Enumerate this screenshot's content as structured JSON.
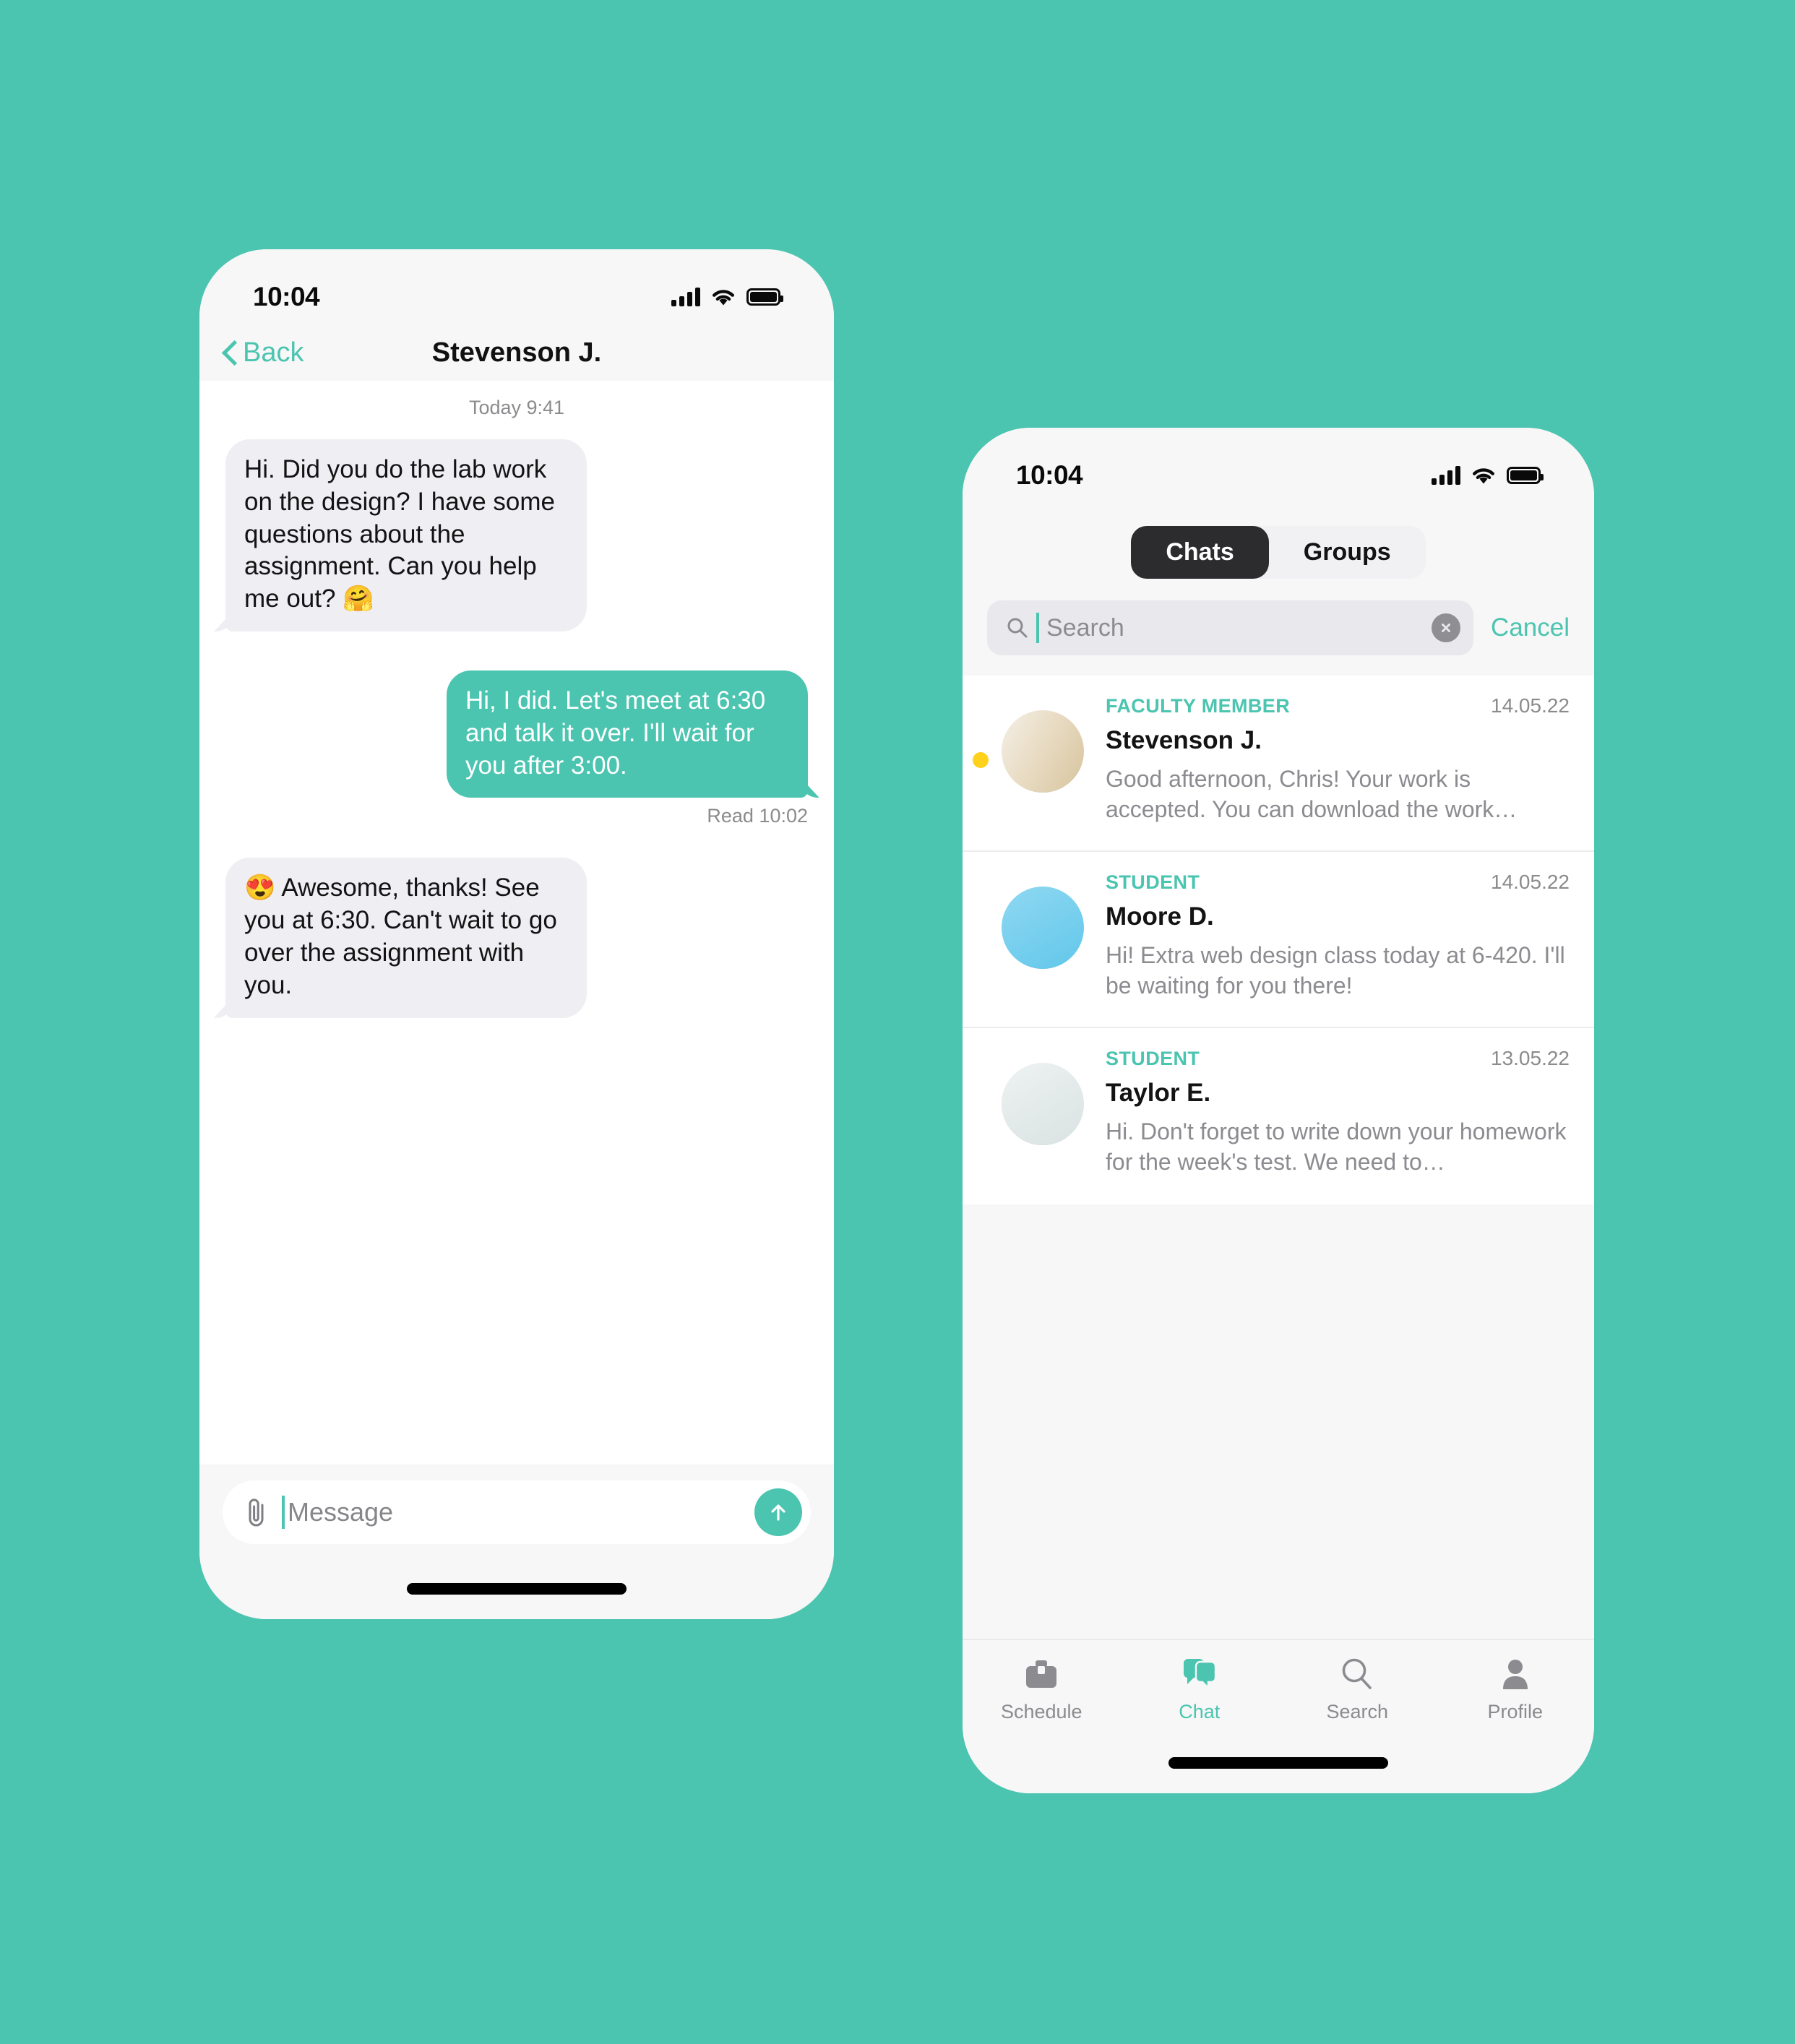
{
  "theme": {
    "background": "#4bc4b0",
    "accent": "#4bc4b0",
    "unread_dot": "#ffd11a",
    "bubble_in": "#eeeef3",
    "bubble_out": "#4bc4b0",
    "tab_active_bg": "#2c2c2e"
  },
  "phone_chat": {
    "status_bar": {
      "time": "10:04"
    },
    "nav": {
      "back_label": "Back",
      "title": "Stevenson J."
    },
    "conversation": {
      "day_stamp": "Today 9:41",
      "messages": [
        {
          "direction": "in",
          "text": "Hi. Did you do the lab work on the design? I have some questions about the assignment. Can you help me out? 🤗"
        },
        {
          "direction": "out",
          "text": "Hi, I did. Let's meet at 6:30 and talk it over. I'll wait for you after 3:00.",
          "receipt": "Read 10:02"
        },
        {
          "direction": "in",
          "text": "😍 Awesome, thanks! See you at 6:30. Can't wait to go over the assignment with you."
        }
      ]
    },
    "composer": {
      "attach_icon": "paperclip-icon",
      "placeholder": "Message",
      "send_icon": "arrow-up-icon"
    }
  },
  "phone_list": {
    "status_bar": {
      "time": "10:04"
    },
    "segmented": {
      "options": [
        "Chats",
        "Groups"
      ],
      "selected": "Chats"
    },
    "search": {
      "icon": "search-icon",
      "placeholder": "Search",
      "value": "",
      "clear_icon": "clear-circle-icon",
      "cancel_label": "Cancel"
    },
    "chats": [
      {
        "role": "FACULTY MEMBER",
        "name": "Stevenson J.",
        "preview": "Good afternoon, Chris! Your work is accepted. You can download the work…",
        "date": "14.05.22",
        "unread": true,
        "avatar": "avatar-stevenson"
      },
      {
        "role": "STUDENT",
        "name": "Moore D.",
        "preview": "Hi! Extra web design class today at 6-420. I'll be waiting for you there!",
        "date": "14.05.22",
        "unread": false,
        "avatar": "avatar-moore"
      },
      {
        "role": "STUDENT",
        "name": "Taylor E.",
        "preview": "Hi. Don't forget to write down your homework for the week's test. We need to…",
        "date": "13.05.22",
        "unread": false,
        "avatar": "avatar-taylor"
      }
    ],
    "tabbar": {
      "items": [
        {
          "label": "Schedule",
          "icon": "briefcase-icon",
          "active": false
        },
        {
          "label": "Chat",
          "icon": "chat-bubbles-icon",
          "active": true
        },
        {
          "label": "Search",
          "icon": "search-icon",
          "active": false
        },
        {
          "label": "Profile",
          "icon": "person-icon",
          "active": false
        }
      ]
    }
  }
}
